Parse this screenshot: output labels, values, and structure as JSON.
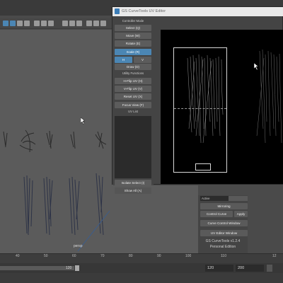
{
  "window": {
    "title": "GS CurveTools UV Editor"
  },
  "side_panel": {
    "controller_mode_header": "Controller Mode",
    "buttons": {
      "select": "Select (Q)",
      "move": "Move (W)",
      "rotate": "Rotate (E)",
      "scale": "Scale (R)",
      "h": "H",
      "v": "V",
      "draw": "Draw (D)"
    },
    "utility_header": "Utility Functions",
    "utility_buttons": {
      "hflip": "H-Flip UV (H)",
      "vflip": "V-Flip UV (V)",
      "reset": "Reset UV (X)",
      "focus": "Focus View (F)"
    },
    "uv_list_header": "UV List",
    "isolate_select": "Isolate Select (I)",
    "show_all": "Show All (A)"
  },
  "control_panel": {
    "top_field": "Active",
    "mirroring": "Mirroring",
    "control_curve": "Control Curve",
    "apply": "Apply",
    "curve_control_window": "Curve Control Window",
    "uv_editor_window": "UV Editor Window",
    "version": "GS CurveTools v1.2.4",
    "edition": "Personal Edition"
  },
  "viewport": {
    "camera_label": "persp"
  },
  "timeline": {
    "ticks": [
      "40",
      "50",
      "60",
      "70",
      "80",
      "90",
      "100",
      "110",
      "12"
    ],
    "range_end": "120",
    "field_1": "120",
    "field_2": "200"
  },
  "colors": {
    "accent": "#4b86b4",
    "canvas": "#000000",
    "panel": "#444444"
  }
}
